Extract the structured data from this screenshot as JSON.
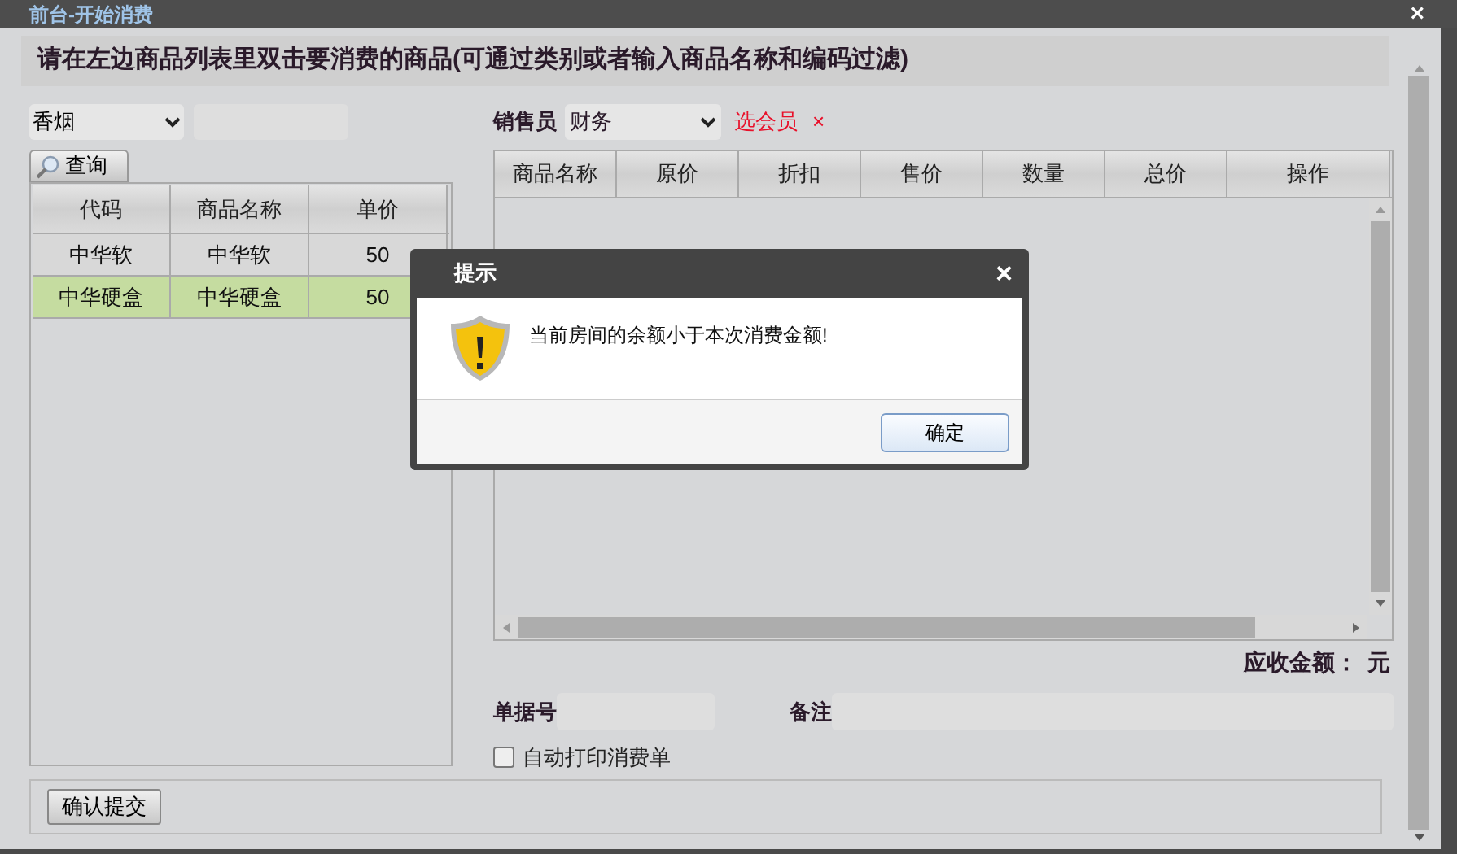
{
  "window": {
    "title": "前台-开始消费",
    "close": "×"
  },
  "instruction": "请在左边商品列表里双击要消费的商品(可通过类别或者输入商品名称和编码过滤)",
  "filter": {
    "category": "香烟"
  },
  "query_button": "查询",
  "product_table": {
    "columns": [
      "代码",
      "商品名称",
      "单价"
    ],
    "rows": [
      {
        "cells": [
          "中华软",
          "中华软",
          "50"
        ],
        "selected": false
      },
      {
        "cells": [
          "中华硬盒",
          "中华硬盒",
          "50"
        ],
        "selected": true
      }
    ]
  },
  "salesperson": {
    "label": "销售员",
    "value": "财务"
  },
  "member_link": "选会员",
  "member_clear": "×",
  "order_table": {
    "columns": [
      "商品名称",
      "原价",
      "折扣",
      "售价",
      "数量",
      "总价",
      "操作"
    ]
  },
  "total": {
    "label": "应收金额：",
    "unit": "元"
  },
  "receipt_no": {
    "label": "单据号"
  },
  "remark": {
    "label": "备注"
  },
  "auto_print": {
    "label": "自动打印消费单",
    "checked": false
  },
  "submit_button": "确认提交",
  "dialog": {
    "title": "提示",
    "close": "×",
    "message": "当前房间的余额小于本次消费金额!",
    "ok_button": "确定"
  }
}
